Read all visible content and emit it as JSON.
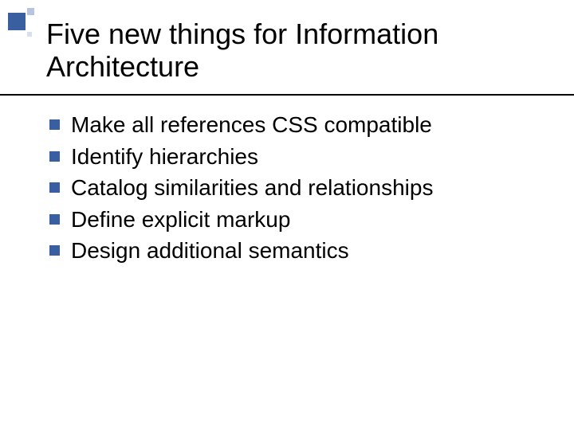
{
  "title": "Five new things for Information Architecture",
  "bullets": [
    "Make all references CSS compatible",
    "Identify hierarchies",
    "Catalog similarities and relationships",
    "Define explicit markup",
    "Design additional semantics"
  ]
}
